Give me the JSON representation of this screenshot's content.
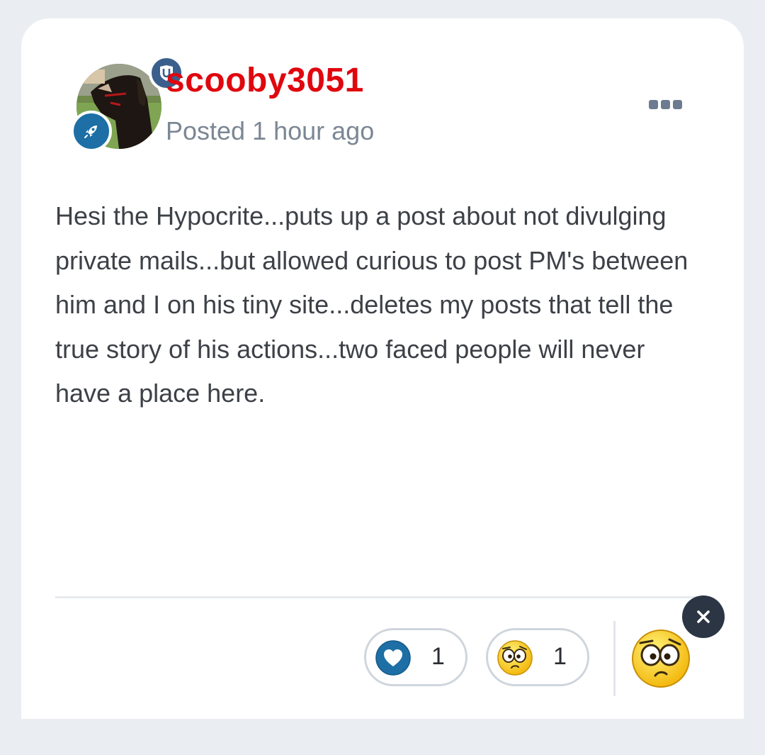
{
  "post": {
    "author": "scooby3051",
    "timestamp": "Posted 1 hour ago",
    "content": "Hesi the Hypocrite...puts up a post about not divulging private mails...but allowed curious to post PM's between him and I on his tiny site...deletes my posts that tell the true story of his actions...two faced people will never have a place here.",
    "author_color": "#e0070e"
  },
  "badges": {
    "moderator_icon": "shield-icon",
    "rank_icon": "rocket-icon"
  },
  "menu": {
    "icon": "ellipsis-icon"
  },
  "reactions": {
    "items": [
      {
        "type": "like",
        "icon": "heart-icon",
        "count": "1"
      },
      {
        "type": "confused",
        "icon": "confused-face-icon",
        "count": "1"
      }
    ],
    "selected_icon": "confused-face-icon",
    "close_icon": "close-icon"
  },
  "colors": {
    "background": "#eaeef3",
    "card": "#ffffff",
    "like_blue": "#1d6fa5",
    "close_button": "#2c3544"
  }
}
